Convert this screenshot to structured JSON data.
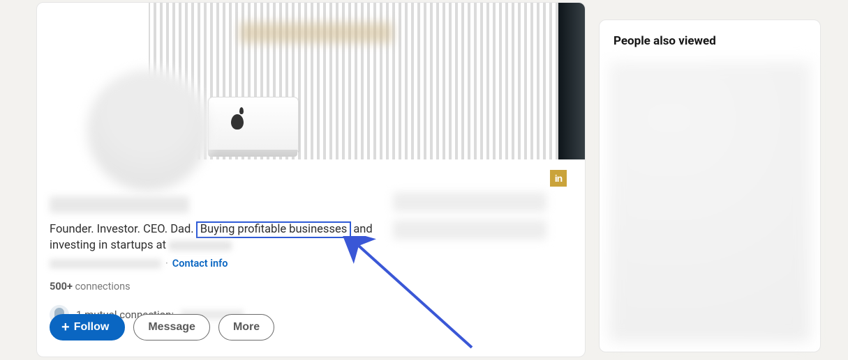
{
  "profile": {
    "headline_pre": "Founder. Investor. CEO. Dad. ",
    "headline_highlight": "Buying profitable businesses",
    "headline_post_1": " and investing in startups at ",
    "contact_info_label": "Contact info",
    "connections_count": "500+",
    "connections_label": " connections",
    "mutual_label": "1 mutual connection:"
  },
  "actions": {
    "follow": "Follow",
    "message": "Message",
    "more": "More"
  },
  "sidebar": {
    "title": "People also viewed"
  },
  "badge": {
    "text": "in"
  }
}
